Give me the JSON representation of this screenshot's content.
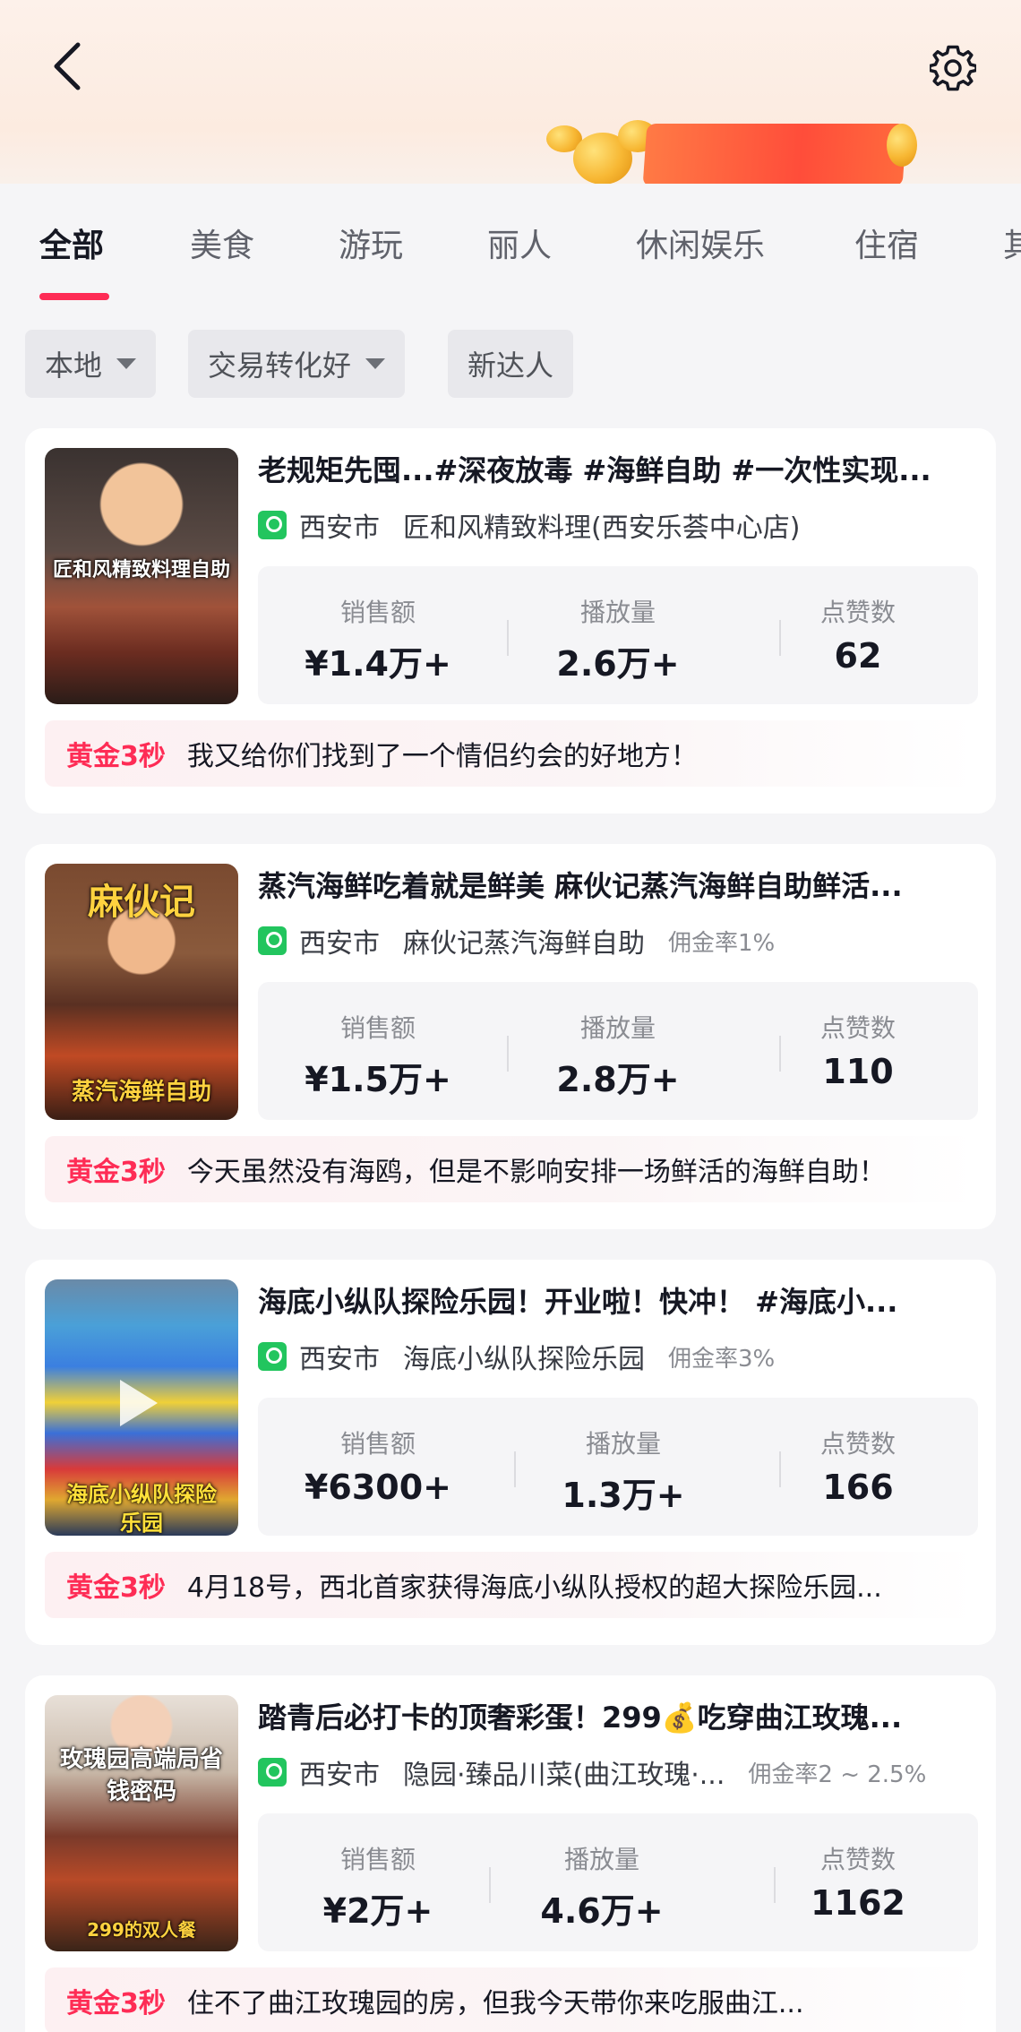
{
  "tabs": [
    {
      "label": "全部",
      "active": true
    },
    {
      "label": "美食"
    },
    {
      "label": "游玩"
    },
    {
      "label": "丽人"
    },
    {
      "label": "休闲娱乐"
    },
    {
      "label": "住宿"
    },
    {
      "label": "其"
    }
  ],
  "filters": [
    {
      "label": "本地",
      "has_dropdown": true
    },
    {
      "label": "交易转化好",
      "has_dropdown": true
    },
    {
      "label": "新达人",
      "has_dropdown": false
    }
  ],
  "stat_labels": {
    "sales": "销售额",
    "plays": "播放量",
    "likes": "点赞数"
  },
  "cards": [
    {
      "thumb_caption": "匠和风精致料理自助",
      "title": "老规矩先囤...#深夜放毒 #海鲜自助 #一次性实现...",
      "city": "西安市",
      "store": "匠和风精致料理(西安乐荟中心店)",
      "commission": "",
      "sales": "¥1.4万+",
      "plays": "2.6万+",
      "likes": "62",
      "badge": "黄金3秒",
      "desc": "我又给你们找到了一个情侣约会的好地方！"
    },
    {
      "thumb_caption": "蒸汽海鲜自助",
      "thumb_caption_top": "麻伙记",
      "title": "蒸汽海鲜吃着就是鲜美 麻伙记蒸汽海鲜自助鲜活...",
      "city": "西安市",
      "store": "麻伙记蒸汽海鲜自助",
      "commission": "佣金率1%",
      "sales": "¥1.5万+",
      "plays": "2.8万+",
      "likes": "110",
      "badge": "黄金3秒",
      "desc": "今天虽然没有海鸥，但是不影响安排一场鲜活的海鲜自助！"
    },
    {
      "thumb_caption": "海底小纵队探险乐园",
      "title": "海底小纵队探险乐园！开业啦！快冲！ #海底小...",
      "city": "西安市",
      "store": "海底小纵队探险乐园",
      "commission": "佣金率3%",
      "sales": "¥6300+",
      "plays": "1.3万+",
      "likes": "166",
      "badge": "黄金3秒",
      "desc": "4月18号，西北首家获得海底小纵队授权的超大探险乐园..."
    },
    {
      "thumb_caption": "玫瑰园高端局省钱密码",
      "thumb_caption_bottom": "299的双人餐",
      "title": "踏青后必打卡的顶奢彩蛋！299💰吃穿曲江玫瑰...",
      "city": "西安市",
      "store": "隐园·臻品川菜(曲江玫瑰·...",
      "commission": "佣金率2 ~ 2.5%",
      "sales": "¥2万+",
      "plays": "4.6万+",
      "likes": "1162",
      "badge": "黄金3秒",
      "desc": "住不了曲江玫瑰园的房，但我今天带你来吃服曲江..."
    }
  ]
}
